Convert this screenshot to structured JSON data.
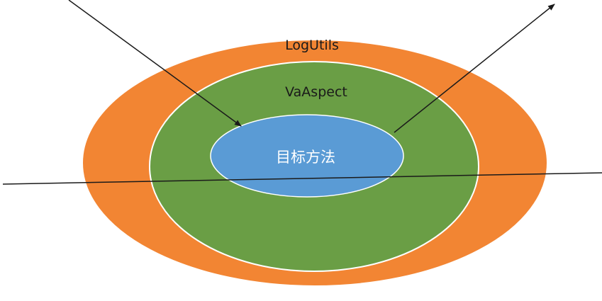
{
  "diagram": {
    "outer_ring": {
      "label": "LogUtils",
      "color": "#F28533"
    },
    "middle_ring": {
      "label": "VaAspect",
      "color": "#6A9E45"
    },
    "core": {
      "label": "目标方法",
      "color": "#5A9BD5"
    },
    "ring_stroke_color": "#ffffff",
    "line_color": "#1a1a1a"
  }
}
